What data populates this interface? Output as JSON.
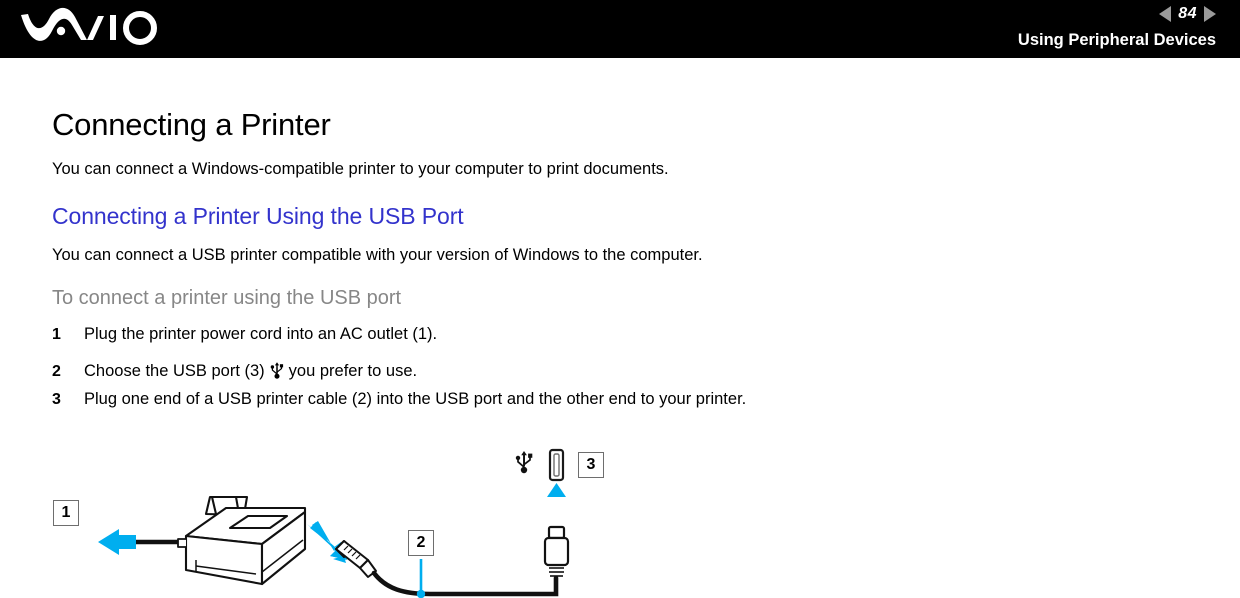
{
  "header": {
    "logo_name": "vaio-logo",
    "page_number": "84",
    "section_title": "Using Peripheral Devices",
    "prev_arrow_icon": "triangle-left-icon",
    "next_arrow_icon": "triangle-right-icon",
    "background_color": "#000000",
    "text_color": "#ffffff",
    "arrow_color": "#9a9a9a"
  },
  "main": {
    "h1": "Connecting a Printer",
    "intro_paragraph": "You can connect a Windows-compatible printer to your computer to print documents.",
    "h2": "Connecting a Printer Using the USB Port",
    "h2_color": "#3333cc",
    "usb_paragraph": "You can connect a USB printer compatible with your version of Windows to the computer.",
    "h3": "To connect a printer using the USB port",
    "h3_color": "#878787",
    "steps": [
      {
        "number": "1",
        "text": "Plug the printer power cord into an AC outlet (1).",
        "has_usb_icon": false
      },
      {
        "number": "2",
        "text_before": "Choose the USB port (3)",
        "text_after": "you prefer to use.",
        "has_usb_icon": true,
        "icon": "usb-trident-icon"
      },
      {
        "number": "3",
        "text": "Plug one end of a USB printer cable (2) into the USB port and the other end to your printer.",
        "has_usb_icon": false
      }
    ]
  },
  "diagram": {
    "name": "printer-usb-connection-diagram",
    "callout_1": "1",
    "callout_2": "2",
    "callout_3": "3",
    "accent_color": "#00AEEF",
    "line_color": "#1a1a1a",
    "box_border_color": "#6e6e6e",
    "parts": [
      {
        "name": "printer-illustration",
        "label": "inkjet printer line drawing"
      },
      {
        "name": "power-cord-line",
        "label": "power cord going left to AC outlet"
      },
      {
        "name": "arrow-left-to-outlet",
        "label": "cyan arrow pointing left"
      },
      {
        "name": "arrow-to-printer-port",
        "label": "cyan arrow pointing at printer USB port"
      },
      {
        "name": "usb-cable",
        "label": "USB printer cable"
      },
      {
        "name": "usb-plug-connector",
        "label": "USB plug connector pointing up"
      },
      {
        "name": "arrow-up-to-computer-port",
        "label": "cyan arrow pointing up to computer USB port"
      },
      {
        "name": "usb-trident-icon",
        "label": "USB symbol above computer port"
      },
      {
        "name": "usb-port-slot-icon",
        "label": "vertical USB port slot"
      },
      {
        "name": "leader-line-2",
        "label": "cyan leader from box 2 to cable"
      }
    ]
  }
}
